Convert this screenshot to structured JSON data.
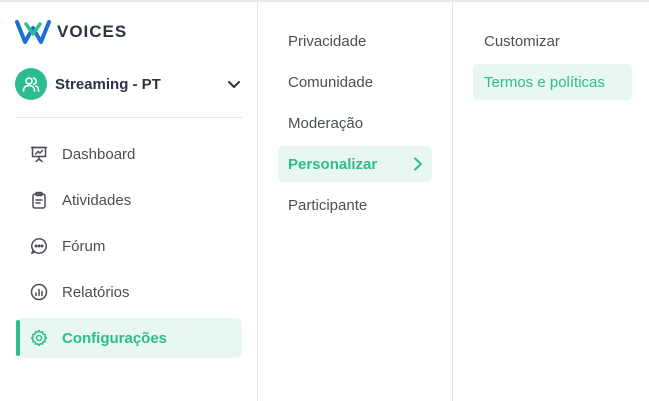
{
  "brand": {
    "name": "VOICES",
    "accent": "#2bbd8f"
  },
  "workspace": {
    "name": "Streaming - PT",
    "icon": "users-icon",
    "dropdown_icon": "chevron-down-icon"
  },
  "sidebar": {
    "items": [
      {
        "label": "Dashboard",
        "icon": "presentation-icon"
      },
      {
        "label": "Atividades",
        "icon": "clipboard-icon"
      },
      {
        "label": "Fórum",
        "icon": "chat-bubble-icon"
      },
      {
        "label": "Relatórios",
        "icon": "chart-icon"
      },
      {
        "label": "Configurações",
        "icon": "gear-icon",
        "active": true
      }
    ]
  },
  "settings_menu": {
    "items": [
      {
        "label": "Privacidade"
      },
      {
        "label": "Comunidade"
      },
      {
        "label": "Moderação"
      },
      {
        "label": "Personalizar",
        "active": true
      },
      {
        "label": "Participante"
      }
    ]
  },
  "personalize_menu": {
    "items": [
      {
        "label": "Customizar"
      },
      {
        "label": "Termos e políticas",
        "active": true
      }
    ]
  }
}
